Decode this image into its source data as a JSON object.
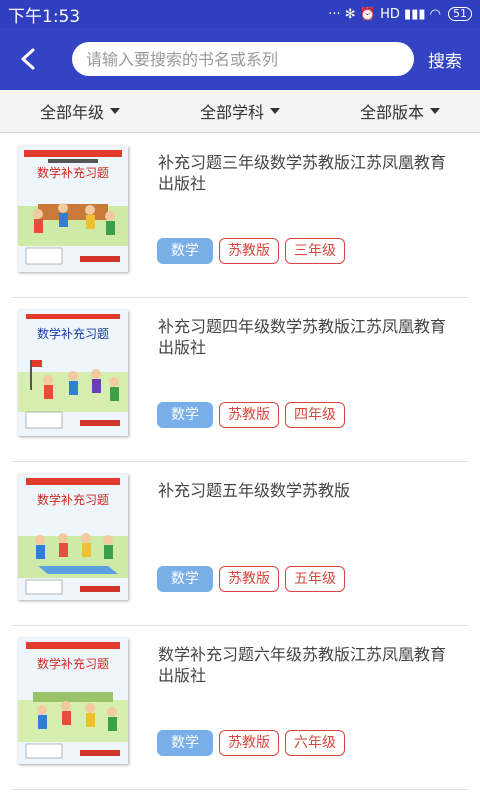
{
  "status": {
    "time": "下午1:53",
    "icons": "··· ✻ ⏰ HD ▮▮▮ ◠",
    "battery": "51"
  },
  "header": {
    "back_icon": "arrow-left-icon",
    "search_placeholder": "请输入要搜索的书名或系列",
    "search_value": "",
    "search_label": "搜索"
  },
  "filters": [
    {
      "label": "全部年级"
    },
    {
      "label": "全部学科"
    },
    {
      "label": "全部版本"
    }
  ],
  "books": [
    {
      "title": "补充习题三年级数学苏教版江苏凤凰教育出版社",
      "cover_title": "数学补充习题",
      "tags": [
        "数学",
        "苏教版",
        "三年级"
      ]
    },
    {
      "title": "补充习题四年级数学苏教版江苏凤凰教育出版社",
      "cover_title": "数学补充习题",
      "tags": [
        "数学",
        "苏教版",
        "四年级"
      ]
    },
    {
      "title": "补充习题五年级数学苏教版",
      "cover_title": "数学补充习题",
      "tags": [
        "数学",
        "苏教版",
        "五年级"
      ]
    },
    {
      "title": "数学补充习题六年级苏教版江苏凤凰教育出版社",
      "cover_title": "数学补充习题",
      "tags": [
        "数学",
        "苏教版",
        "六年级"
      ]
    }
  ]
}
